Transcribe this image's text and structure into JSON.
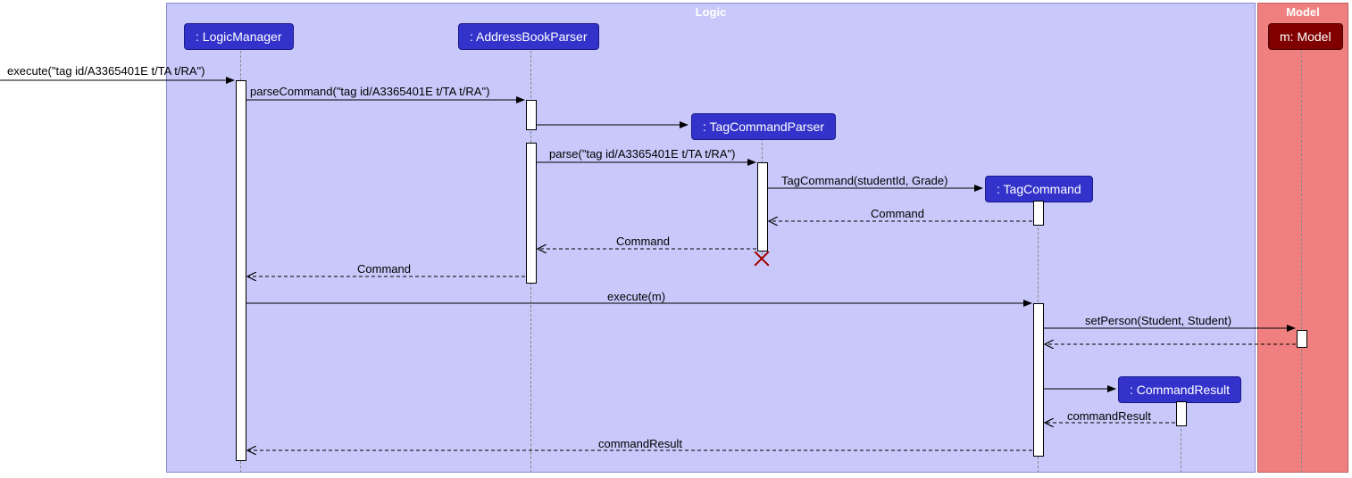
{
  "boxes": {
    "logic": {
      "title": "Logic",
      "color": "#6060c0"
    },
    "model": {
      "title": "Model",
      "color": "#fff"
    }
  },
  "participants": {
    "logicManager": ": LogicManager",
    "addressBookParser": ": AddressBookParser",
    "tagCommandParser": ": TagCommandParser",
    "tagCommand": ": TagCommand",
    "commandResult": ": CommandResult",
    "model": "m: Model"
  },
  "messages": {
    "m1": "execute(\"tag id/A3365401E t/TA t/RA\")",
    "m2": "parseCommand(\"tag id/A3365401E t/TA t/RA\")",
    "m3": "parse(\"tag id/A3365401E t/TA t/RA\")",
    "m4": "TagCommand(studentId, Grade)",
    "m5": "Command",
    "m6": "Command",
    "m7": "Command",
    "m8": "execute(m)",
    "m9": "setPerson(Student, Student)",
    "m10": "commandResult",
    "m11": "commandResult"
  },
  "chart_data": {
    "type": "sequence_diagram",
    "boxes": [
      {
        "name": "Logic",
        "participants": [
          "LogicManager",
          "AddressBookParser",
          "TagCommandParser",
          "TagCommand",
          "CommandResult"
        ]
      },
      {
        "name": "Model",
        "participants": [
          "m: Model"
        ]
      }
    ],
    "participants": [
      {
        "id": "LogicManager",
        "label": ": LogicManager"
      },
      {
        "id": "AddressBookParser",
        "label": ": AddressBookParser"
      },
      {
        "id": "TagCommandParser",
        "label": ": TagCommandParser",
        "created": true,
        "destroyed": true
      },
      {
        "id": "TagCommand",
        "label": ": TagCommand",
        "created": true
      },
      {
        "id": "CommandResult",
        "label": ": CommandResult",
        "created": true
      },
      {
        "id": "Model",
        "label": "m: Model"
      }
    ],
    "messages": [
      {
        "from": "external",
        "to": "LogicManager",
        "label": "execute(\"tag id/A3365401E t/TA t/RA\")",
        "type": "sync"
      },
      {
        "from": "LogicManager",
        "to": "AddressBookParser",
        "label": "parseCommand(\"tag id/A3365401E t/TA t/RA\")",
        "type": "sync"
      },
      {
        "from": "AddressBookParser",
        "to": "TagCommandParser",
        "label": "",
        "type": "create"
      },
      {
        "from": "AddressBookParser",
        "to": "TagCommandParser",
        "label": "parse(\"tag id/A3365401E t/TA t/RA\")",
        "type": "sync"
      },
      {
        "from": "TagCommandParser",
        "to": "TagCommand",
        "label": "TagCommand(studentId, Grade)",
        "type": "create"
      },
      {
        "from": "TagCommand",
        "to": "TagCommandParser",
        "label": "Command",
        "type": "return"
      },
      {
        "from": "TagCommandParser",
        "to": "AddressBookParser",
        "label": "Command",
        "type": "return"
      },
      {
        "from": "TagCommandParser",
        "to": null,
        "label": "",
        "type": "destroy"
      },
      {
        "from": "AddressBookParser",
        "to": "LogicManager",
        "label": "Command",
        "type": "return"
      },
      {
        "from": "LogicManager",
        "to": "TagCommand",
        "label": "execute(m)",
        "type": "sync"
      },
      {
        "from": "TagCommand",
        "to": "Model",
        "label": "setPerson(Student, Student)",
        "type": "sync"
      },
      {
        "from": "Model",
        "to": "TagCommand",
        "label": "",
        "type": "return"
      },
      {
        "from": "TagCommand",
        "to": "CommandResult",
        "label": "",
        "type": "create"
      },
      {
        "from": "CommandResult",
        "to": "TagCommand",
        "label": "commandResult",
        "type": "return"
      },
      {
        "from": "TagCommand",
        "to": "LogicManager",
        "label": "commandResult",
        "type": "return"
      }
    ]
  }
}
